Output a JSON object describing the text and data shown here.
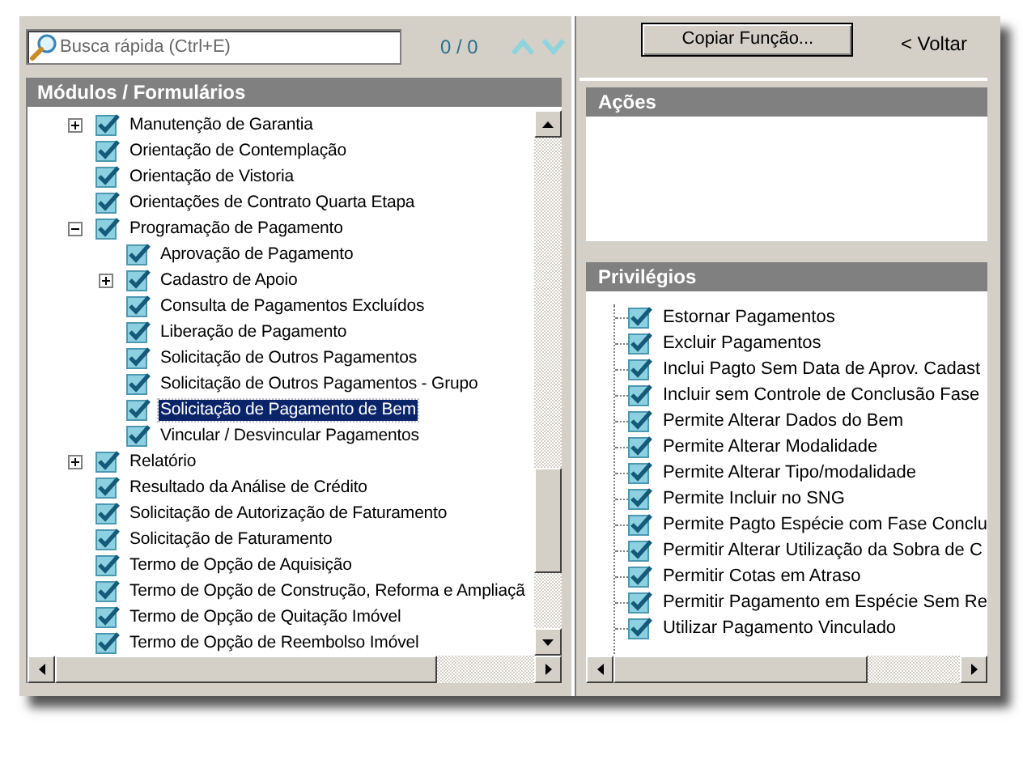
{
  "search": {
    "placeholder": "Busca rápida (Ctrl+E)",
    "count": "0 / 0"
  },
  "toolbar": {
    "copy_button": "Copiar Função...",
    "back_link": "< Voltar"
  },
  "modules": {
    "title": "Módulos / Formulários",
    "items": [
      {
        "label": "Manutenção de Garantia",
        "checked": true,
        "selected": false,
        "expanded": false
      },
      {
        "label": "Orientação de Contemplação",
        "checked": true,
        "selected": false
      },
      {
        "label": "Orientação de Vistoria",
        "checked": true,
        "selected": false
      },
      {
        "label": "Orientações de Contrato Quarta Etapa",
        "checked": true,
        "selected": false
      },
      {
        "label": "Programação de Pagamento",
        "checked": true,
        "selected": false,
        "expanded": true,
        "children": [
          {
            "label": "Aprovação de Pagamento",
            "checked": true,
            "selected": false
          },
          {
            "label": "Cadastro de Apoio",
            "checked": true,
            "selected": false,
            "expanded": false
          },
          {
            "label": "Consulta de Pagamentos Excluídos",
            "checked": true,
            "selected": false
          },
          {
            "label": "Liberação de Pagamento",
            "checked": true,
            "selected": false
          },
          {
            "label": "Solicitação de Outros Pagamentos",
            "checked": true,
            "selected": false
          },
          {
            "label": "Solicitação de Outros Pagamentos - Grupo",
            "checked": true,
            "selected": false
          },
          {
            "label": "Solicitação de Pagamento de Bem",
            "checked": true,
            "selected": true
          },
          {
            "label": "Vincular / Desvincular Pagamentos",
            "checked": true,
            "selected": false
          }
        ]
      },
      {
        "label": "Relatório",
        "checked": true,
        "selected": false,
        "expanded": false
      },
      {
        "label": "Resultado da Análise de Crédito",
        "checked": true,
        "selected": false
      },
      {
        "label": "Solicitação de Autorização de Faturamento",
        "checked": true,
        "selected": false
      },
      {
        "label": "Solicitação de Faturamento",
        "checked": true,
        "selected": false
      },
      {
        "label": "Termo de Opção de Aquisição",
        "checked": true,
        "selected": false
      },
      {
        "label": "Termo de Opção de Construção, Reforma e Ampliaçã",
        "checked": true,
        "selected": false
      },
      {
        "label": "Termo de Opção de Quitação Imóvel",
        "checked": true,
        "selected": false
      },
      {
        "label": "Termo de Opção de Reembolso Imóvel",
        "checked": true,
        "selected": false
      }
    ]
  },
  "actions": {
    "title": "Ações"
  },
  "privileges": {
    "title": "Privilégios",
    "items": [
      {
        "label": "Estornar Pagamentos",
        "checked": true
      },
      {
        "label": "Excluir Pagamentos",
        "checked": true
      },
      {
        "label": "Inclui Pagto Sem Data de Aprov. Cadast",
        "checked": true
      },
      {
        "label": "Incluir sem Controle de Conclusão Fase",
        "checked": true
      },
      {
        "label": "Permite Alterar Dados do Bem",
        "checked": true
      },
      {
        "label": "Permite Alterar Modalidade",
        "checked": true
      },
      {
        "label": "Permite Alterar Tipo/modalidade",
        "checked": true
      },
      {
        "label": "Permite Incluir no SNG",
        "checked": true
      },
      {
        "label": "Permite Pagto Espécie com Fase Conclu",
        "checked": true
      },
      {
        "label": "Permitir Alterar Utilização da Sobra de C",
        "checked": true
      },
      {
        "label": "Permitir Cotas em Atraso",
        "checked": true
      },
      {
        "label": "Permitir Pagamento em Espécie Sem Re",
        "checked": true
      },
      {
        "label": "Utilizar Pagamento Vinculado",
        "checked": true
      }
    ]
  }
}
